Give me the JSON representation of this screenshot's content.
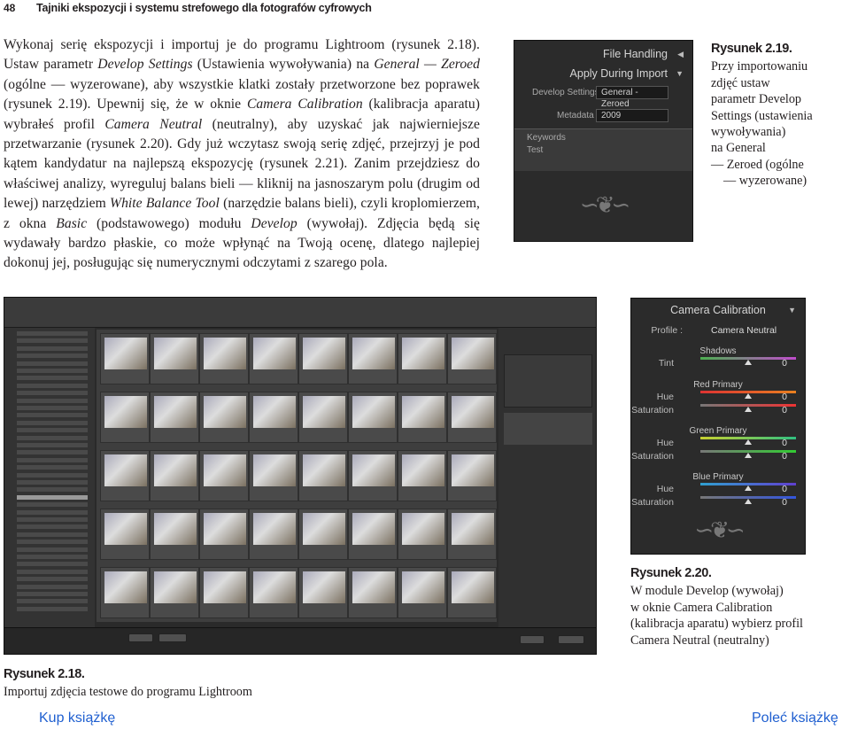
{
  "header": {
    "page_number": "48",
    "chapter_title": "Tajniki ekspozycji i systemu strefowego dla fotografów cyfrowych"
  },
  "body_paragraph": {
    "s1": "Wykonaj serię ekspozycji i importuj je do programu Lightroom (rysunek 2.18). Ustaw parametr ",
    "i1": "Develop Settings",
    "s2": " (Ustawienia wywoływania) na ",
    "i2": "General — Zeroed",
    "s3": " (ogólne — wyzerowane), aby wszystkie klatki zostały przetworzone bez poprawek (rysunek 2.19). Upewnij się, że w oknie ",
    "i3": "Camera Calibration",
    "s4": " (kalibracja aparatu) wybrałeś profil ",
    "i4": "Camera Neutral",
    "s5": " (neutralny), aby uzyskać jak najwierniejsze przetwarzanie (rysunek 2.20). Gdy już wczytasz swoją serię zdjęć, przejrzyj je pod kątem kandydatur na najlepszą ekspozycję (rysunek 2.21). Zanim przejdziesz do właściwej analizy, wyreguluj balans bieli — kliknij na jasnoszarym polu (drugim od lewej) narzędziem ",
    "i5": "White Balance Tool",
    "s6": " (narzędzie balans bieli), czyli kroplomierzem, z okna ",
    "i6": "Basic",
    "s7": " (podstawowego) modułu ",
    "i7": "Develop",
    "s8": " (wywołaj). Zdjęcia będą się wydawały bardzo płaskie, co może wpłynąć na Twoją ocenę, dlatego najlepiej dokonuj jej, posługując się numerycznymi odczytami z szarego pola."
  },
  "fig219": {
    "label": "Rysunek 2.19.",
    "lines": [
      "Przy importowaniu",
      "zdjęć ustaw",
      "parametr Develop",
      "Settings (ustawienia",
      "wywoływania)",
      "na General",
      "— Zeroed (ogólne",
      "— wyzerowane)"
    ],
    "panel": {
      "file_handling": "File Handling",
      "apply_during_import": "Apply During Import",
      "develop_settings_label": "Develop Settings",
      "develop_settings_value": "General - Zeroed",
      "metadata_label": "Metadata",
      "metadata_value": "2009",
      "keywords_label": "Keywords",
      "keywords_value": "Test"
    }
  },
  "fig220": {
    "label": "Rysunek 2.20.",
    "lines": [
      "W module Develop (wywołaj)",
      "w oknie Camera Calibration",
      "(kalibracja aparatu) wybierz profil",
      "Camera Neutral (neutralny)"
    ],
    "panel": {
      "title": "Camera Calibration",
      "profile_label": "Profile :",
      "profile_value": "Camera Neutral",
      "shadows": "Shadows",
      "tint": "Tint",
      "red_primary": "Red Primary",
      "green_primary": "Green Primary",
      "blue_primary": "Blue Primary",
      "hue": "Hue",
      "saturation": "Saturation",
      "zero": "0"
    }
  },
  "fig218": {
    "label": "Rysunek 2.18.",
    "text": "Importuj zdjęcia testowe do programu Lightroom"
  },
  "links": {
    "buy": "Kup książkę",
    "recommend": "Poleć książkę"
  },
  "colors": {
    "link": "#1f5fd0",
    "panel_bg": "#2b2b2b"
  }
}
